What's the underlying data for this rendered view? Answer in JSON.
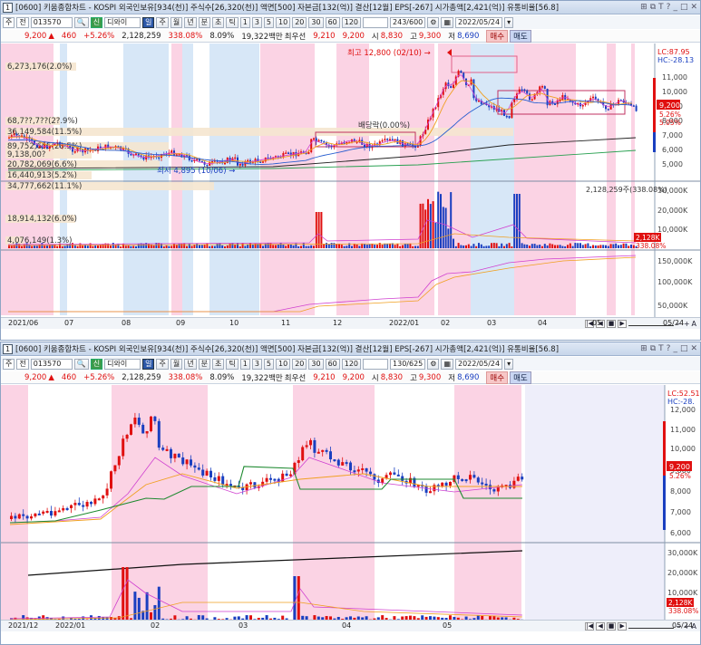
{
  "top_window": {
    "title": "[0600] 키움종합차트 - KOSPI 외국인보유[934(천)] 주식수[26,320(천)] 액면[500] 자본금[132(억)] 결산[12월] EPS[-267] 시가총액[2,421(억)] 유통비율[56.8]",
    "win_no": "1",
    "toolbar": {
      "type1": "주",
      "type2": "전",
      "code": "013570",
      "name": "디와이",
      "periods": [
        "일",
        "주",
        "월",
        "년",
        "분",
        "초",
        "틱"
      ],
      "intervals": [
        "1",
        "3",
        "5",
        "10",
        "20",
        "30",
        "60",
        "120"
      ],
      "count": "243/600",
      "date": "2022/05/24"
    },
    "quote": {
      "price": "9,200",
      "arrow": "▲",
      "change": "460",
      "pct": "+5.26%",
      "volume": "2,128,259",
      "vol_ratio": "338.08%",
      "turnover": "8.09%",
      "amount": "19,322백만",
      "label_low": "최우선",
      "ask": "9,210",
      "bid": "9,200",
      "open_l": "시",
      "open": "8,830",
      "high_l": "고",
      "high": "9,300",
      "low_l": "저",
      "low": "8,690",
      "buy": "매수",
      "sell": "매도"
    },
    "annotations": {
      "hi": "최고 12,800 (02/10) →",
      "lo": "최저 4,895 (10/06) →",
      "div": "배당락(0.00%)",
      "vp": [
        "6,273,176(2.0%)",
        "68,7??,7??(2?.9%)",
        "36,149,584(11.5%)",
        "89,752,655(28.5%)",
        "9,138,00?",
        "20,782,069(6.6%)",
        "16,440,913(5.2%)",
        "34,777,662(11.1%)",
        "18,914,132(6.0%)",
        "4,076,149(1.3%)"
      ],
      "vol_label": "2,128,259주(338.08%)"
    },
    "axis": {
      "lc": "LC:87.95",
      "hc": "HC:-28.13",
      "price_ticks": [
        "11,000",
        "10,000",
        "9,000",
        "8,000",
        "7,000",
        "6,000",
        "5,000"
      ],
      "price_tag": "9,200",
      "pct_tag": "5.26%",
      "pct2": "5.05%",
      "vol_ticks": [
        "30,000K",
        "20,000K",
        "10,000K"
      ],
      "vol_tag": "2,128K",
      "vol_tag2": "338.08%",
      "obv_ticks": [
        "150,000K",
        "100,000K",
        "50,000K"
      ],
      "dates": [
        "2021/06",
        "07",
        "08",
        "09",
        "10",
        "11",
        "12",
        "2022/01",
        "02",
        "03",
        "04",
        "05",
        "05/24"
      ]
    }
  },
  "bottom_window": {
    "title": "[0600] 키움종합차트 - KOSPI 외국인보유[934(천)] 주식수[26,320(천)] 액면[500] 자본금[132(억)] 결산[12월] EPS[-267] 시가총액[2,421(억)] 유통비율[56.8]",
    "win_no": "1",
    "toolbar": {
      "type1": "주",
      "type2": "전",
      "code": "013570",
      "name": "디와이",
      "periods": [
        "일",
        "주",
        "월",
        "년",
        "분",
        "초",
        "틱"
      ],
      "intervals": [
        "1",
        "3",
        "5",
        "10",
        "20",
        "30",
        "60",
        "120"
      ],
      "count": "130/625",
      "date": "2022/05/24"
    },
    "axis": {
      "lc": "LC:52.51",
      "hc": "HC:-28.",
      "price_ticks": [
        "12,000",
        "11,000",
        "10,000",
        "9,000",
        "8,000",
        "7,000",
        "6,000"
      ],
      "price_tag": "9,200",
      "pct_tag": "5.26%",
      "vol_ticks": [
        "30,000K",
        "20,000K",
        "10,000K"
      ],
      "vol_tag": "2,128K",
      "vol_tag2": "338.08%",
      "dates": [
        "2021/12",
        "2022/01",
        "02",
        "03",
        "04",
        "05",
        "05/24"
      ]
    }
  },
  "colors": {
    "up": "#e01010",
    "down": "#1a3fc0",
    "band": "#fbd3e4",
    "bar": "#d7e7f7"
  }
}
